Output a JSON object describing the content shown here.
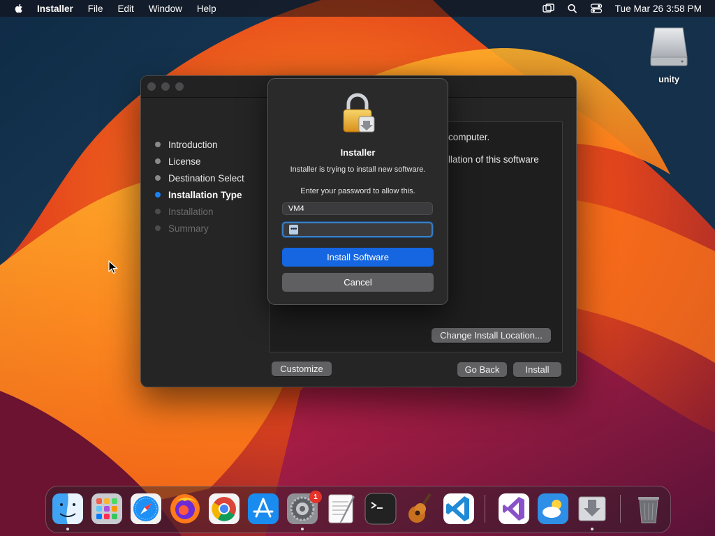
{
  "menubar": {
    "app_name": "Installer",
    "items": [
      "File",
      "Edit",
      "Window",
      "Help"
    ],
    "clock": "Tue Mar 26  3:58 PM"
  },
  "desktop": {
    "volume_label": "unity"
  },
  "installer": {
    "steps": [
      {
        "label": "Introduction",
        "state": "done"
      },
      {
        "label": "License",
        "state": "done"
      },
      {
        "label": "Destination Select",
        "state": "done"
      },
      {
        "label": "Installation Type",
        "state": "active"
      },
      {
        "label": "Installation",
        "state": "pending"
      },
      {
        "label": "Summary",
        "state": "pending"
      }
    ],
    "content_line1": "computer.",
    "content_line2": "llation of this software",
    "change_location_label": "Change Install Location...",
    "customize_label": "Customize",
    "go_back_label": "Go Back",
    "install_label": "Install"
  },
  "auth_dialog": {
    "title": "Installer",
    "message": "Installer is trying to install new software.",
    "prompt": "Enter your password to allow this.",
    "username": "VM4",
    "password_mask": "•••",
    "primary_label": "Install Software",
    "cancel_label": "Cancel"
  },
  "dock": {
    "items": [
      "finder-icon",
      "launchpad-icon",
      "safari-icon",
      "firefox-icon",
      "chrome-icon",
      "app-store-icon",
      "system-settings-icon",
      "textedit-icon",
      "terminal-icon",
      "garageband-icon",
      "vscode-icon",
      "visual-studio-icon",
      "weather-icon",
      "installer-icon",
      "trash-icon"
    ],
    "settings_badge": "1"
  },
  "colors": {
    "accent": "#1566e0",
    "active_step": "#1a82f5"
  }
}
